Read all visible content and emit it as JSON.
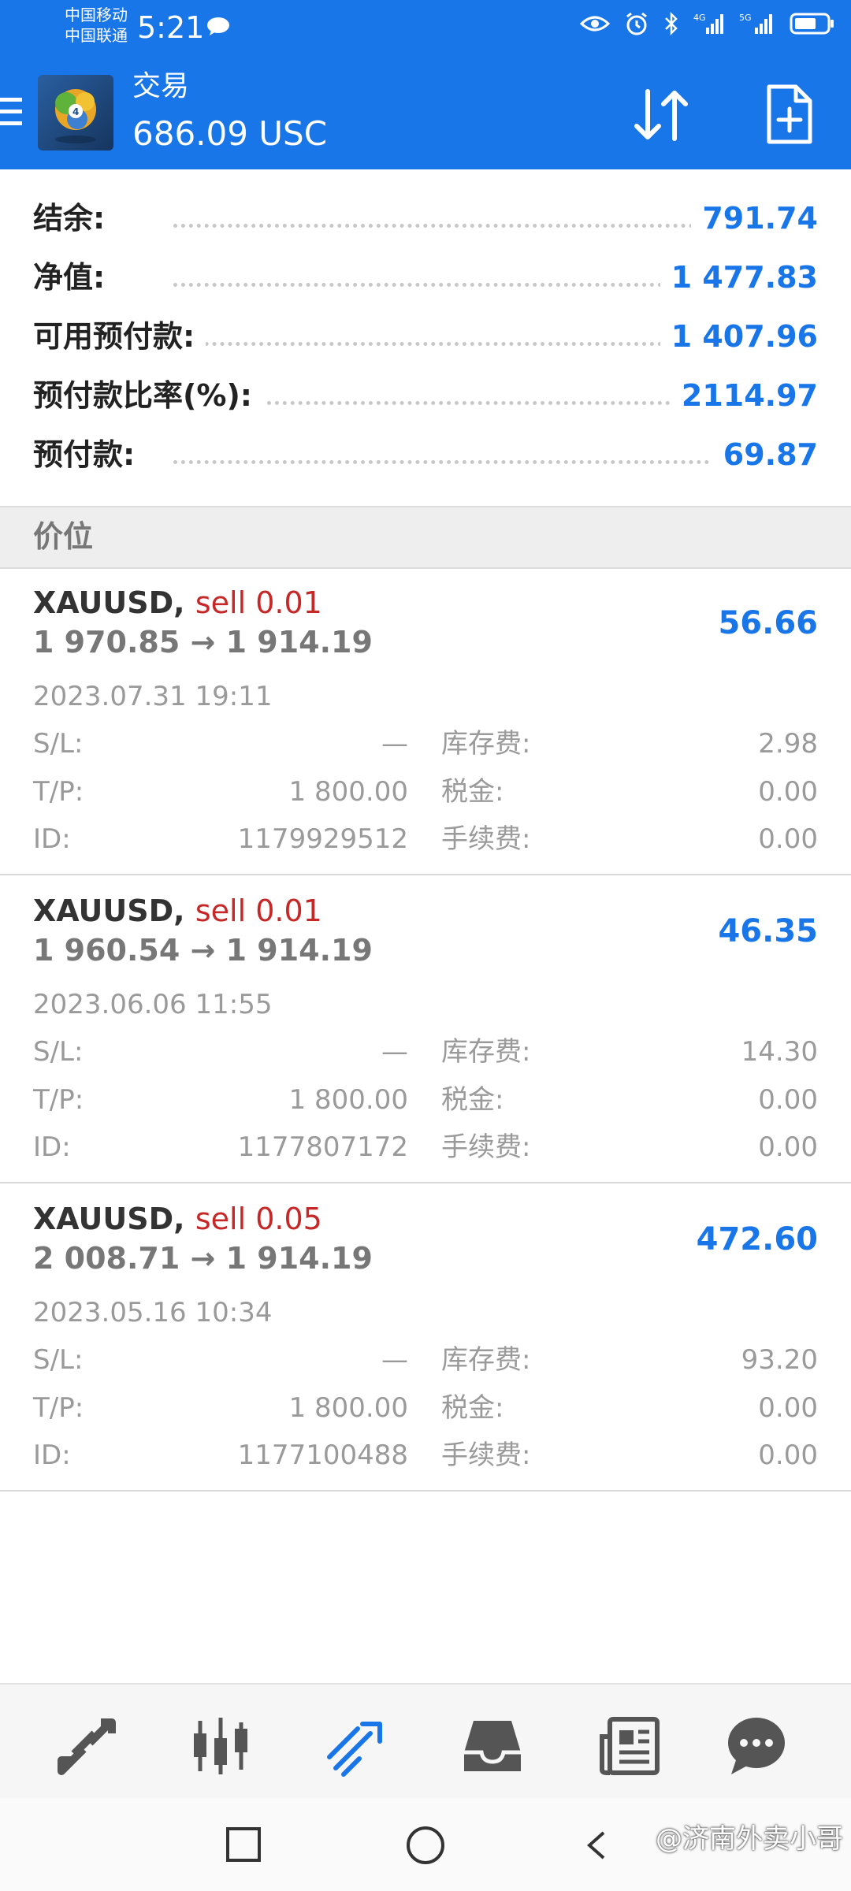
{
  "status_bar": {
    "carrier1": "中国移动",
    "carrier2": "中国联通",
    "time": "5:21"
  },
  "app_bar": {
    "title": "交易",
    "balance": "686.09 USC"
  },
  "summary": [
    {
      "label": "结余:",
      "value": "791.74"
    },
    {
      "label": "净值:",
      "value": "1 477.83"
    },
    {
      "label": "可用预付款:",
      "value": "1 407.96"
    },
    {
      "label": "预付款比率(%):",
      "value": "2114.97"
    },
    {
      "label": "预付款:",
      "value": "69.87"
    }
  ],
  "section_title": "价位",
  "positions": [
    {
      "symbol": "XAUUSD,",
      "side": "sell 0.01",
      "prices": "1 970.85 → 1 914.19",
      "profit": "56.66",
      "time": "2023.07.31 19:11",
      "sl_label": "S/L:",
      "sl": "—",
      "tp_label": "T/P:",
      "tp": "1 800.00",
      "id_label": "ID:",
      "id": "1179929512",
      "swap_label": "库存费:",
      "swap": "2.98",
      "tax_label": "税金:",
      "tax": "0.00",
      "fee_label": "手续费:",
      "fee": "0.00"
    },
    {
      "symbol": "XAUUSD,",
      "side": "sell 0.01",
      "prices": "1 960.54 → 1 914.19",
      "profit": "46.35",
      "time": "2023.06.06 11:55",
      "sl_label": "S/L:",
      "sl": "—",
      "tp_label": "T/P:",
      "tp": "1 800.00",
      "id_label": "ID:",
      "id": "1177807172",
      "swap_label": "库存费:",
      "swap": "14.30",
      "tax_label": "税金:",
      "tax": "0.00",
      "fee_label": "手续费:",
      "fee": "0.00"
    },
    {
      "symbol": "XAUUSD,",
      "side": "sell 0.05",
      "prices": "2 008.71 → 1 914.19",
      "profit": "472.60",
      "time": "2023.05.16 10:34",
      "sl_label": "S/L:",
      "sl": "—",
      "tp_label": "T/P:",
      "tp": "1 800.00",
      "id_label": "ID:",
      "id": "1177100488",
      "swap_label": "库存费:",
      "swap": "93.20",
      "tax_label": "税金:",
      "tax": "0.00",
      "fee_label": "手续费:",
      "fee": "0.00"
    }
  ],
  "bottom_nav": {
    "items": [
      "quotes-icon",
      "chart-icon",
      "trade-icon",
      "history-icon",
      "news-icon",
      "chat-icon"
    ],
    "active": "trade-icon",
    "active_color": "#1976e8",
    "inactive_color": "#555555"
  },
  "watermark": "@济南外卖小哥",
  "colors": {
    "accent": "#1976e8",
    "sell": "#c62828"
  }
}
